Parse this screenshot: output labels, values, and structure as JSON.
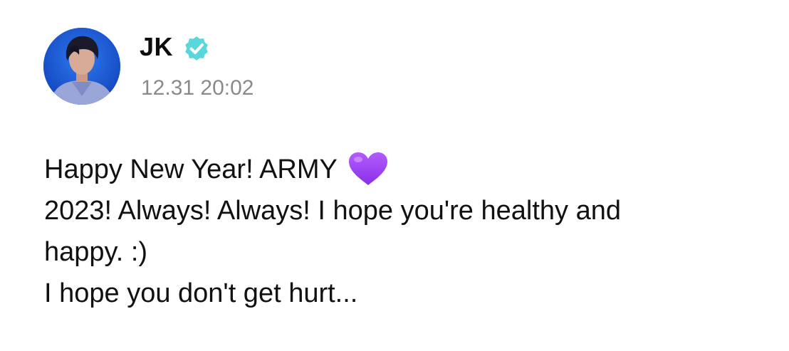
{
  "author": {
    "name": "JK",
    "verified": true,
    "badge_color": "#5ad7dc"
  },
  "post": {
    "timestamp": "12.31 20:02",
    "lines": [
      "Happy New Year! ARMY",
      "2023! Always! Always! I hope you're healthy and",
      "happy. :)",
      "I hope you don't get hurt..."
    ],
    "emoji": "purple-heart"
  },
  "colors": {
    "text": "#111111",
    "timestamp": "#8a8a8a",
    "heart": "#9b3ff0",
    "avatar_bg": "#1f63d8"
  }
}
